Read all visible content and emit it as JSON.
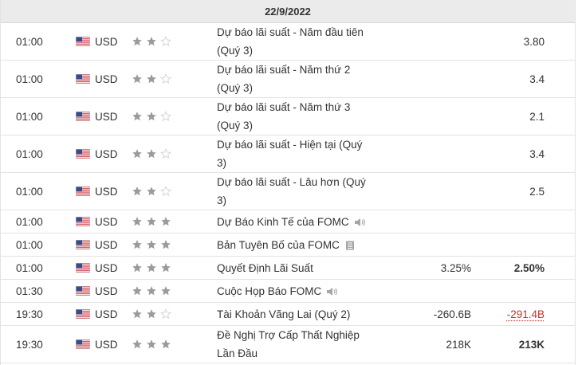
{
  "date_header": "22/9/2022",
  "rows": [
    {
      "time": "01:00",
      "currency": "USD",
      "importance": 2,
      "event_line1": "Dự báo lãi suất - Năm đầu tiên",
      "event_line2": "(Quý 3)",
      "actual": "",
      "forecast": "3.80",
      "icon": ""
    },
    {
      "time": "01:00",
      "currency": "USD",
      "importance": 2,
      "event_line1": "Dự báo lãi suất - Năm thứ 2",
      "event_line2": "(Quý 3)",
      "actual": "",
      "forecast": "3.4",
      "icon": ""
    },
    {
      "time": "01:00",
      "currency": "USD",
      "importance": 2,
      "event_line1": "Dự báo lãi suất - Năm thứ 3",
      "event_line2": "(Quý 3)",
      "actual": "",
      "forecast": "2.1",
      "icon": ""
    },
    {
      "time": "01:00",
      "currency": "USD",
      "importance": 2,
      "event_line1": "Dự báo lãi suất - Hiện tại (Quý",
      "event_line2": "3)",
      "actual": "",
      "forecast": "3.4",
      "icon": ""
    },
    {
      "time": "01:00",
      "currency": "USD",
      "importance": 2,
      "event_line1": "Dự báo lãi suất - Lâu hơn (Quý",
      "event_line2": "3)",
      "actual": "",
      "forecast": "2.5",
      "icon": ""
    },
    {
      "time": "01:00",
      "currency": "USD",
      "importance": 3,
      "event_line1": "Dự Báo Kinh Tế của FOMC",
      "event_line2": "",
      "actual": "",
      "forecast": "",
      "icon": "speaker-icon"
    },
    {
      "time": "01:00",
      "currency": "USD",
      "importance": 3,
      "event_line1": "Bản Tuyên Bố của FOMC",
      "event_line2": "",
      "actual": "",
      "forecast": "",
      "icon": "document-icon"
    },
    {
      "time": "01:00",
      "currency": "USD",
      "importance": 3,
      "event_line1": "Quyết Định Lãi Suất",
      "event_line2": "",
      "actual": "3.25%",
      "forecast": "2.50%",
      "icon": ""
    },
    {
      "time": "01:30",
      "currency": "USD",
      "importance": 3,
      "event_line1": "Cuộc Họp Báo FOMC",
      "event_line2": "",
      "actual": "",
      "forecast": "",
      "icon": "speaker-icon"
    },
    {
      "time": "19:30",
      "currency": "USD",
      "importance": 2,
      "event_line1": "Tài Khoản Vãng Lai (Quý 2)",
      "event_line2": "",
      "actual": "-260.6B",
      "forecast": "-291.4B",
      "icon": ""
    },
    {
      "time": "19:30",
      "currency": "USD",
      "importance": 3,
      "event_line1": "Đề Nghị Trợ Cấp Thất Nghiệp",
      "event_line2": "Lần Đầu",
      "actual": "218K",
      "forecast": "213K",
      "icon": ""
    }
  ],
  "colors": {
    "star_filled": "#9b9b9b",
    "star_empty": "#d4d4d4",
    "negative": "#c0342c"
  }
}
